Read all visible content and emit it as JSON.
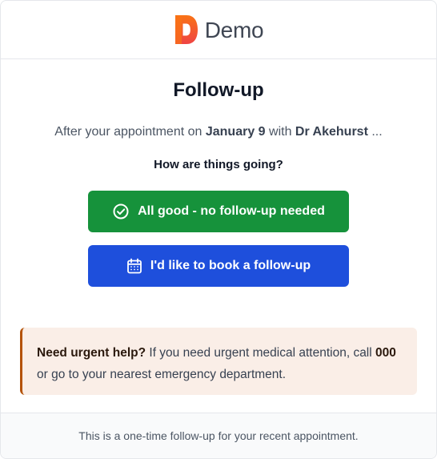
{
  "header": {
    "logo_letter": "D",
    "brand_name": "Demo"
  },
  "main": {
    "title": "Follow-up",
    "intro": {
      "prefix": "After your appointment on ",
      "date": "January 9",
      "middle": " with ",
      "doctor": "Dr Akehurst",
      "suffix": " ..."
    },
    "question": "How are things going?",
    "buttons": {
      "all_good_label": "All good - no follow-up needed",
      "book_label": "I'd like to book a follow-up"
    }
  },
  "alert": {
    "heading": "Need urgent help?",
    "text_before": " If you need urgent medical attention, call ",
    "emergency_number": "000",
    "text_after": " or go to your nearest emergency department."
  },
  "footer": {
    "text": "This is a one-time follow-up for your recent appointment."
  },
  "colors": {
    "logo_gradient_top": "#f97316",
    "logo_gradient_bottom": "#ef4444",
    "success_button": "#16923b",
    "primary_button": "#1e4fdc",
    "alert_background": "#faeee7",
    "alert_border": "#b45309",
    "footer_background": "#f9fafb"
  },
  "icons": {
    "logo": "demo-d-logo",
    "all_good": "check-circle-icon",
    "book": "calendar-icon"
  }
}
